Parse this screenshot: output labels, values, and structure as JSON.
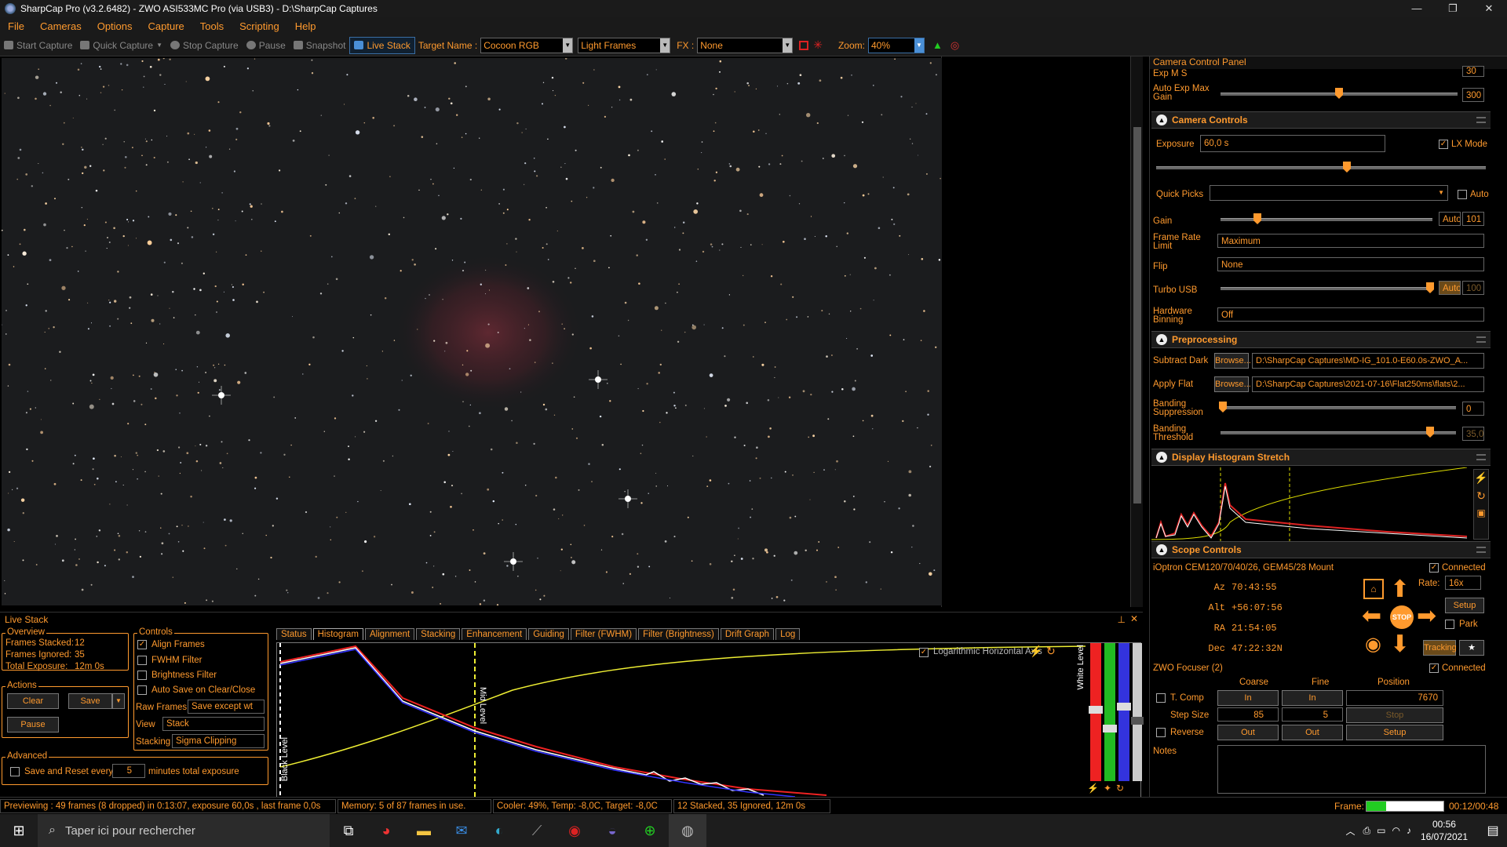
{
  "window": {
    "title": "SharpCap Pro (v3.2.6482) - ZWO ASI533MC Pro (via USB3) - D:\\SharpCap Captures",
    "controls": [
      "—",
      "❐",
      "✕"
    ]
  },
  "menu": [
    "File",
    "Cameras",
    "Options",
    "Capture",
    "Tools",
    "Scripting",
    "Help"
  ],
  "toolbar": {
    "start_capture": "Start Capture",
    "quick_capture": "Quick Capture",
    "stop_capture": "Stop Capture",
    "pause": "Pause",
    "snapshot": "Snapshot",
    "live_stack": "Live Stack",
    "target_name_label": "Target Name :",
    "target_name": "Cocoon RGB",
    "frame_type": "Light Frames",
    "fx_label": "FX :",
    "fx_value": "None",
    "zoom_label": "Zoom:",
    "zoom_value": "40%"
  },
  "ccp": {
    "title": "Camera Control Panel",
    "exp_ms_label": "Exp M S",
    "exp_ms_value": "30",
    "auto_exp_max_gain_label": "Auto Exp Max\nGain",
    "auto_exp_max_gain_value": "300",
    "camera_controls": {
      "title": "Camera Controls",
      "exposure_label": "Exposure",
      "exposure_value": "60,0 s",
      "lx_mode_label": "LX Mode",
      "quick_picks_label": "Quick Picks",
      "auto_label": "Auto",
      "gain_label": "Gain",
      "gain_auto": "Auto",
      "gain_value": "101",
      "frame_rate_label": "Frame Rate\nLimit",
      "frame_rate_value": "Maximum",
      "flip_label": "Flip",
      "flip_value": "None",
      "turbo_usb_label": "Turbo USB",
      "turbo_auto": "Auto",
      "turbo_value": "100",
      "hw_binning_label": "Hardware\nBinning",
      "hw_binning_value": "Off"
    },
    "preprocessing": {
      "title": "Preprocessing",
      "subtract_dark_label": "Subtract Dark",
      "browse": "Browse...",
      "subtract_dark_value": "D:\\SharpCap Captures\\MD-IG_101.0-E60.0s-ZWO_A...",
      "apply_flat_label": "Apply Flat",
      "apply_flat_value": "D:\\SharpCap Captures\\2021-07-16\\Flat250ms\\flats\\2...",
      "banding_supp_label": "Banding\nSuppression",
      "banding_supp_value": "0",
      "banding_thr_label": "Banding\nThreshold",
      "banding_thr_value": "35,0"
    },
    "display_histogram": {
      "title": "Display Histogram Stretch"
    },
    "scope": {
      "title": "Scope Controls",
      "mount": "iOptron CEM120/70/40/26, GEM45/28 Mount",
      "connected": "Connected",
      "az_label": "Az",
      "az_value": "70:43:55",
      "alt_label": "Alt",
      "alt_value": "+56:07:56",
      "ra_label": "RA",
      "ra_value": "21:54:05",
      "dec_label": "Dec",
      "dec_value": "47:22:32N",
      "rate_label": "Rate:",
      "rate_value": "16x",
      "setup": "Setup",
      "park": "Park",
      "stop": "STOP",
      "tracking": "Tracking"
    },
    "focuser": {
      "title": "ZWO Focuser (2)",
      "connected": "Connected",
      "coarse": "Coarse",
      "fine": "Fine",
      "position": "Position",
      "tcomp": "T. Comp",
      "in1": "In",
      "in2": "In",
      "position_value": "7670",
      "step_size": "Step Size",
      "coarse_step": "85",
      "fine_step": "5",
      "stop": "Stop",
      "reverse": "Reverse",
      "out1": "Out",
      "out2": "Out",
      "setup": "Setup",
      "notes": "Notes"
    }
  },
  "livestack": {
    "title": "Live Stack",
    "overview": "Overview",
    "frames_stacked_label": "Frames Stacked:",
    "frames_stacked": "12",
    "frames_ignored_label": "Frames Ignored:",
    "frames_ignored": "35",
    "total_exposure_label": "Total Exposure:",
    "total_exposure": "12m 0s",
    "actions": "Actions",
    "clear": "Clear",
    "save": "Save",
    "pause": "Pause",
    "advanced": "Advanced",
    "save_reset_label": "Save and Reset every",
    "save_reset_value": "5",
    "minutes_label": "minutes total exposure",
    "controls": "Controls",
    "align_frames": "Align Frames",
    "fwhm_filter": "FWHM Filter",
    "brightness_filter": "Brightness Filter",
    "auto_save": "Auto Save on Clear/Close",
    "raw_frames_label": "Raw Frames",
    "raw_frames_value": "Save except wt",
    "view_label": "View",
    "view_value": "Stack",
    "stacking_label": "Stacking",
    "stacking_value": "Sigma Clipping",
    "tabs": [
      "Status",
      "Histogram",
      "Alignment",
      "Stacking",
      "Enhancement",
      "Guiding",
      "Filter (FWHM)",
      "Filter (Brightness)",
      "Drift Graph",
      "Log"
    ],
    "log_axis": "Logarithmic Horizontal Axis",
    "black_level": "Black Level",
    "mid_level": "Mid Level",
    "white_level": "White Level"
  },
  "status": {
    "preview": "Previewing : 49 frames (8 dropped) in 0:13:07, exposure 60,0s , last frame 0,0s",
    "memory": "Memory: 5 of 87 frames in use.",
    "cooler": "Cooler: 49%, Temp: -8,0C, Target: -8,0C",
    "stacked": "12 Stacked, 35 Ignored, 12m 0s",
    "frame_label": "Frame:",
    "frame_time": "00:12/00:48"
  },
  "taskbar": {
    "search_placeholder": "Taper ici pour rechercher",
    "time": "00:56",
    "date": "16/07/2021"
  },
  "colors": {
    "accent": "#ff9a2e",
    "bg": "#000000"
  }
}
